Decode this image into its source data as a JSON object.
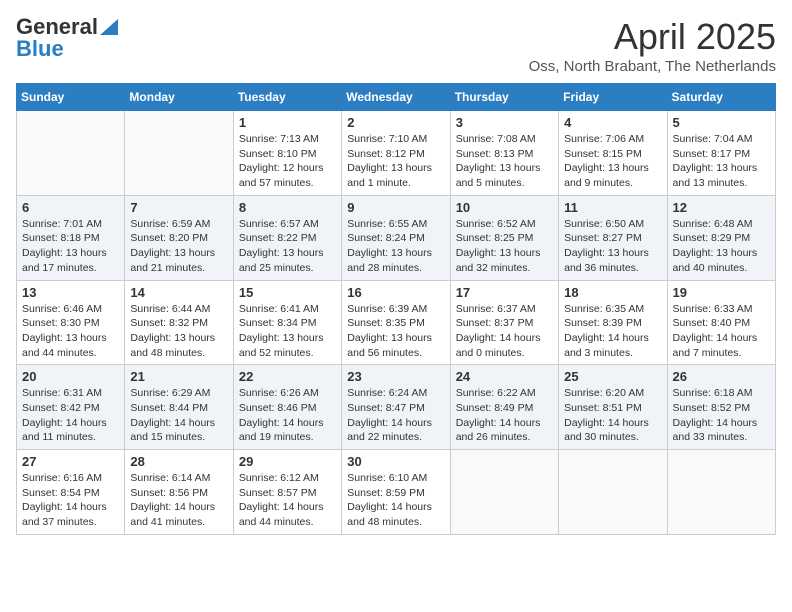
{
  "header": {
    "logo_general": "General",
    "logo_blue": "Blue",
    "title": "April 2025",
    "subtitle": "Oss, North Brabant, The Netherlands"
  },
  "weekdays": [
    "Sunday",
    "Monday",
    "Tuesday",
    "Wednesday",
    "Thursday",
    "Friday",
    "Saturday"
  ],
  "weeks": [
    [
      {
        "day": "",
        "info": ""
      },
      {
        "day": "",
        "info": ""
      },
      {
        "day": "1",
        "info": "Sunrise: 7:13 AM\nSunset: 8:10 PM\nDaylight: 12 hours and 57 minutes."
      },
      {
        "day": "2",
        "info": "Sunrise: 7:10 AM\nSunset: 8:12 PM\nDaylight: 13 hours and 1 minute."
      },
      {
        "day": "3",
        "info": "Sunrise: 7:08 AM\nSunset: 8:13 PM\nDaylight: 13 hours and 5 minutes."
      },
      {
        "day": "4",
        "info": "Sunrise: 7:06 AM\nSunset: 8:15 PM\nDaylight: 13 hours and 9 minutes."
      },
      {
        "day": "5",
        "info": "Sunrise: 7:04 AM\nSunset: 8:17 PM\nDaylight: 13 hours and 13 minutes."
      }
    ],
    [
      {
        "day": "6",
        "info": "Sunrise: 7:01 AM\nSunset: 8:18 PM\nDaylight: 13 hours and 17 minutes."
      },
      {
        "day": "7",
        "info": "Sunrise: 6:59 AM\nSunset: 8:20 PM\nDaylight: 13 hours and 21 minutes."
      },
      {
        "day": "8",
        "info": "Sunrise: 6:57 AM\nSunset: 8:22 PM\nDaylight: 13 hours and 25 minutes."
      },
      {
        "day": "9",
        "info": "Sunrise: 6:55 AM\nSunset: 8:24 PM\nDaylight: 13 hours and 28 minutes."
      },
      {
        "day": "10",
        "info": "Sunrise: 6:52 AM\nSunset: 8:25 PM\nDaylight: 13 hours and 32 minutes."
      },
      {
        "day": "11",
        "info": "Sunrise: 6:50 AM\nSunset: 8:27 PM\nDaylight: 13 hours and 36 minutes."
      },
      {
        "day": "12",
        "info": "Sunrise: 6:48 AM\nSunset: 8:29 PM\nDaylight: 13 hours and 40 minutes."
      }
    ],
    [
      {
        "day": "13",
        "info": "Sunrise: 6:46 AM\nSunset: 8:30 PM\nDaylight: 13 hours and 44 minutes."
      },
      {
        "day": "14",
        "info": "Sunrise: 6:44 AM\nSunset: 8:32 PM\nDaylight: 13 hours and 48 minutes."
      },
      {
        "day": "15",
        "info": "Sunrise: 6:41 AM\nSunset: 8:34 PM\nDaylight: 13 hours and 52 minutes."
      },
      {
        "day": "16",
        "info": "Sunrise: 6:39 AM\nSunset: 8:35 PM\nDaylight: 13 hours and 56 minutes."
      },
      {
        "day": "17",
        "info": "Sunrise: 6:37 AM\nSunset: 8:37 PM\nDaylight: 14 hours and 0 minutes."
      },
      {
        "day": "18",
        "info": "Sunrise: 6:35 AM\nSunset: 8:39 PM\nDaylight: 14 hours and 3 minutes."
      },
      {
        "day": "19",
        "info": "Sunrise: 6:33 AM\nSunset: 8:40 PM\nDaylight: 14 hours and 7 minutes."
      }
    ],
    [
      {
        "day": "20",
        "info": "Sunrise: 6:31 AM\nSunset: 8:42 PM\nDaylight: 14 hours and 11 minutes."
      },
      {
        "day": "21",
        "info": "Sunrise: 6:29 AM\nSunset: 8:44 PM\nDaylight: 14 hours and 15 minutes."
      },
      {
        "day": "22",
        "info": "Sunrise: 6:26 AM\nSunset: 8:46 PM\nDaylight: 14 hours and 19 minutes."
      },
      {
        "day": "23",
        "info": "Sunrise: 6:24 AM\nSunset: 8:47 PM\nDaylight: 14 hours and 22 minutes."
      },
      {
        "day": "24",
        "info": "Sunrise: 6:22 AM\nSunset: 8:49 PM\nDaylight: 14 hours and 26 minutes."
      },
      {
        "day": "25",
        "info": "Sunrise: 6:20 AM\nSunset: 8:51 PM\nDaylight: 14 hours and 30 minutes."
      },
      {
        "day": "26",
        "info": "Sunrise: 6:18 AM\nSunset: 8:52 PM\nDaylight: 14 hours and 33 minutes."
      }
    ],
    [
      {
        "day": "27",
        "info": "Sunrise: 6:16 AM\nSunset: 8:54 PM\nDaylight: 14 hours and 37 minutes."
      },
      {
        "day": "28",
        "info": "Sunrise: 6:14 AM\nSunset: 8:56 PM\nDaylight: 14 hours and 41 minutes."
      },
      {
        "day": "29",
        "info": "Sunrise: 6:12 AM\nSunset: 8:57 PM\nDaylight: 14 hours and 44 minutes."
      },
      {
        "day": "30",
        "info": "Sunrise: 6:10 AM\nSunset: 8:59 PM\nDaylight: 14 hours and 48 minutes."
      },
      {
        "day": "",
        "info": ""
      },
      {
        "day": "",
        "info": ""
      },
      {
        "day": "",
        "info": ""
      }
    ]
  ]
}
